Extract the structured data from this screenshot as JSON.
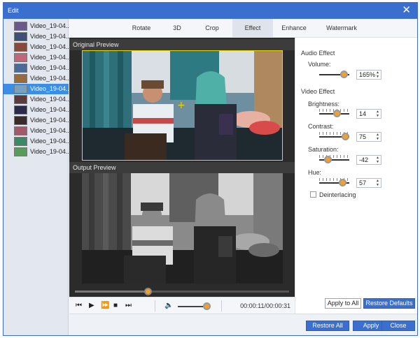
{
  "window": {
    "title": "Edit"
  },
  "clips": {
    "items": [
      {
        "name": "Video_19-04...",
        "thumb_color": "#6a5a8a",
        "selected": false
      },
      {
        "name": "Video_19-04...",
        "thumb_color": "#3e4f7a",
        "selected": false
      },
      {
        "name": "Video_19-04...",
        "thumb_color": "#8a4a3a",
        "selected": false
      },
      {
        "name": "Video_19-04...",
        "thumb_color": "#c0687a",
        "selected": false
      },
      {
        "name": "Video_19-04...",
        "thumb_color": "#4a6a9a",
        "selected": false
      },
      {
        "name": "Video_19-04...",
        "thumb_color": "#9a6a3a",
        "selected": false
      },
      {
        "name": "Video_19-04...",
        "thumb_color": "#7aa0c0",
        "selected": true
      },
      {
        "name": "Video_19-04...",
        "thumb_color": "#5a3a3a",
        "selected": false
      },
      {
        "name": "Video_19-04...",
        "thumb_color": "#2a2a4a",
        "selected": false
      },
      {
        "name": "Video_19-04...",
        "thumb_color": "#3a2a2a",
        "selected": false
      },
      {
        "name": "Video_19-04...",
        "thumb_color": "#a05a6a",
        "selected": false
      },
      {
        "name": "Video_19-04...",
        "thumb_color": "#3a8a6a",
        "selected": false
      },
      {
        "name": "Video_19-04...",
        "thumb_color": "#5a9a5a",
        "selected": false
      }
    ]
  },
  "tabs": {
    "rotate": "Rotate",
    "threed": "3D",
    "crop": "Crop",
    "effect": "Effect",
    "enhance": "Enhance",
    "watermark": "Watermark",
    "active": "effect"
  },
  "preview": {
    "original_label": "Original Preview",
    "output_label": "Output Preview",
    "progress_fraction": 0.34
  },
  "playback": {
    "prev_icon": "skip-back-icon",
    "play_icon": "play-icon",
    "next_icon": "fast-forward-icon",
    "stop_icon": "stop-icon",
    "end_icon": "skip-forward-icon",
    "volume_icon": "speaker-icon",
    "volume_fraction": 0.92,
    "timecode": "00:00:11/00:00:31"
  },
  "effects": {
    "audio_title": "Audio Effect",
    "volume_label": "Volume:",
    "volume_value": "165%",
    "volume_fraction": 0.82,
    "video_title": "Video Effect",
    "brightness_label": "Brightness:",
    "brightness_value": "14",
    "brightness_fraction": 0.57,
    "contrast_label": "Contrast:",
    "contrast_value": "75",
    "contrast_fraction": 0.87,
    "saturation_label": "Saturation:",
    "saturation_value": "-42",
    "saturation_fraction": 0.29,
    "hue_label": "Hue:",
    "hue_value": "57",
    "hue_fraction": 0.76,
    "deinterlacing_label": "Deinterlacing",
    "deinterlacing_checked": false
  },
  "buttons": {
    "apply_to_all": "Apply to All",
    "restore_defaults": "Restore Defaults",
    "restore_all": "Restore All",
    "apply": "Apply",
    "close": "Close"
  },
  "colors": {
    "accent": "#3a6fd0",
    "selection": "#3b8ee6",
    "slider_knob": "#f0a030",
    "crop_frame": "#e8d800"
  }
}
